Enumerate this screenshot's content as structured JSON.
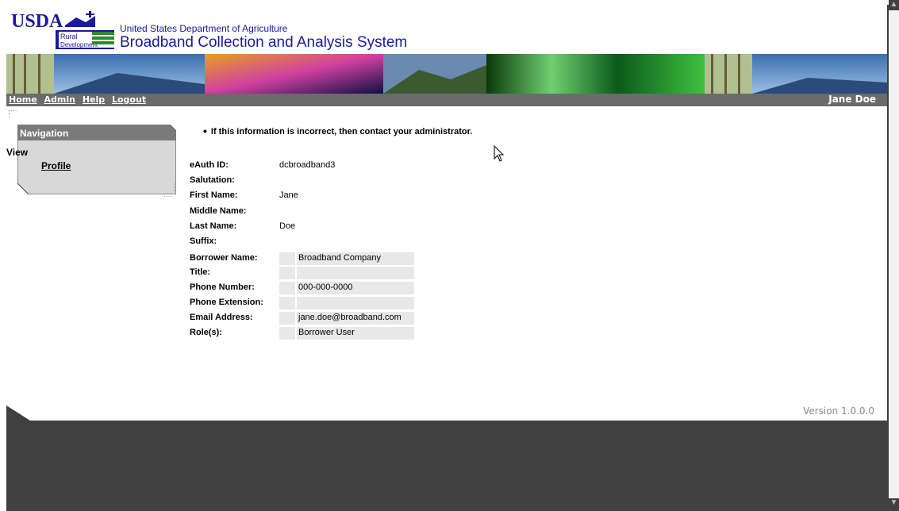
{
  "header": {
    "logo_text": "USDA",
    "logo_sub1": "Rural",
    "logo_sub2": "Development",
    "department": "United States Department of Agriculture",
    "system_title": "Broadband Collection and Analysis System"
  },
  "navbar": {
    "links": [
      "Home",
      "Admin",
      "Help",
      "Logout"
    ],
    "user": "Jane Doe"
  },
  "navigation": {
    "title": "Navigation",
    "section": "View",
    "item": "Profile"
  },
  "notice": "If this information is incorrect, then contact your administrator.",
  "profile": {
    "rows": [
      {
        "label": "eAuth ID:",
        "value": "dcbroadband3"
      },
      {
        "label": "Salutation:",
        "value": ""
      },
      {
        "label": "First Name:",
        "value": "Jane"
      },
      {
        "label": "Middle Name:",
        "value": ""
      },
      {
        "label": "Last Name:",
        "value": "Doe"
      },
      {
        "label": "Suffix:",
        "value": ""
      }
    ],
    "table_rows": [
      {
        "label": "Borrower Name:",
        "value": "Broadband Company"
      },
      {
        "label": "Title:",
        "value": ""
      },
      {
        "label": "Phone Number:",
        "value": "000-000-0000"
      },
      {
        "label": "Phone Extension:",
        "value": ""
      },
      {
        "label": "Email Address:",
        "value": "jane.doe@broadband.com"
      },
      {
        "label": "Role(s):",
        "value": "Borrower User"
      }
    ]
  },
  "version": "Version 1.0.0.0",
  "icons": {
    "cursor": "arrow-cursor-icon",
    "usda_logo": "usda-logo-icon"
  },
  "colors": {
    "navbar": "#6b6b6b",
    "title_blue": "#1a1a9c",
    "footer_dark": "#404040"
  }
}
